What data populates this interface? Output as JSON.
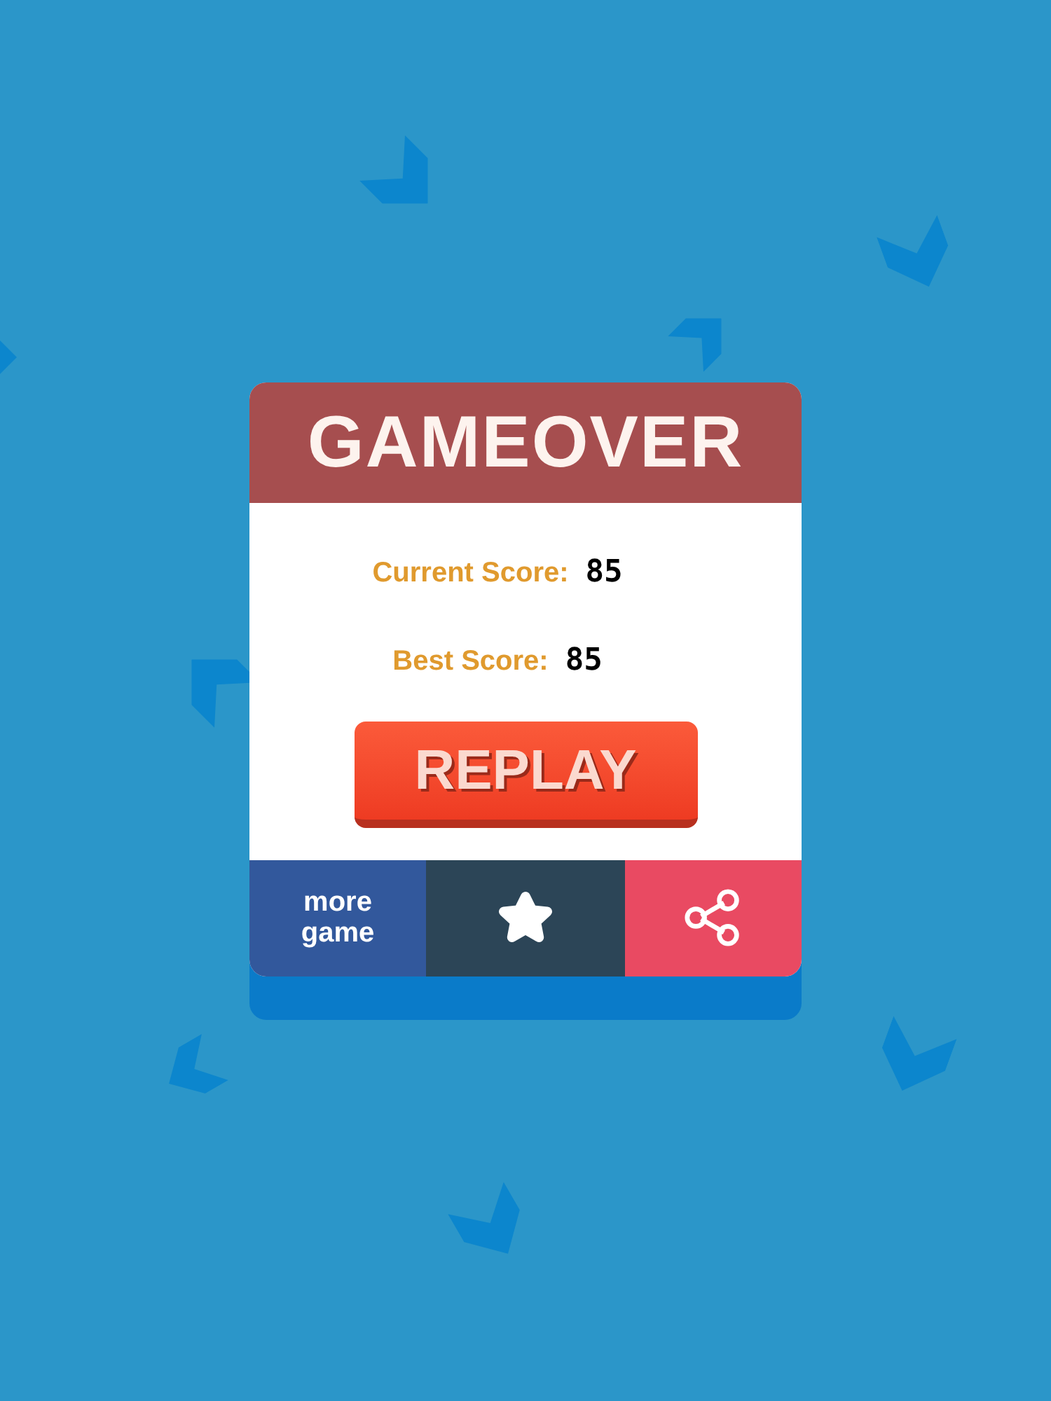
{
  "title": "GAMEOVER",
  "scores": [
    {
      "label": "Current Score:",
      "value": "85"
    },
    {
      "label": "Best Score:",
      "value": "85"
    }
  ],
  "replay_button": {
    "label": "REPLAY"
  },
  "bottom_buttons": [
    {
      "kind": "text",
      "label": "more game"
    },
    {
      "kind": "star"
    },
    {
      "kind": "share"
    }
  ]
}
